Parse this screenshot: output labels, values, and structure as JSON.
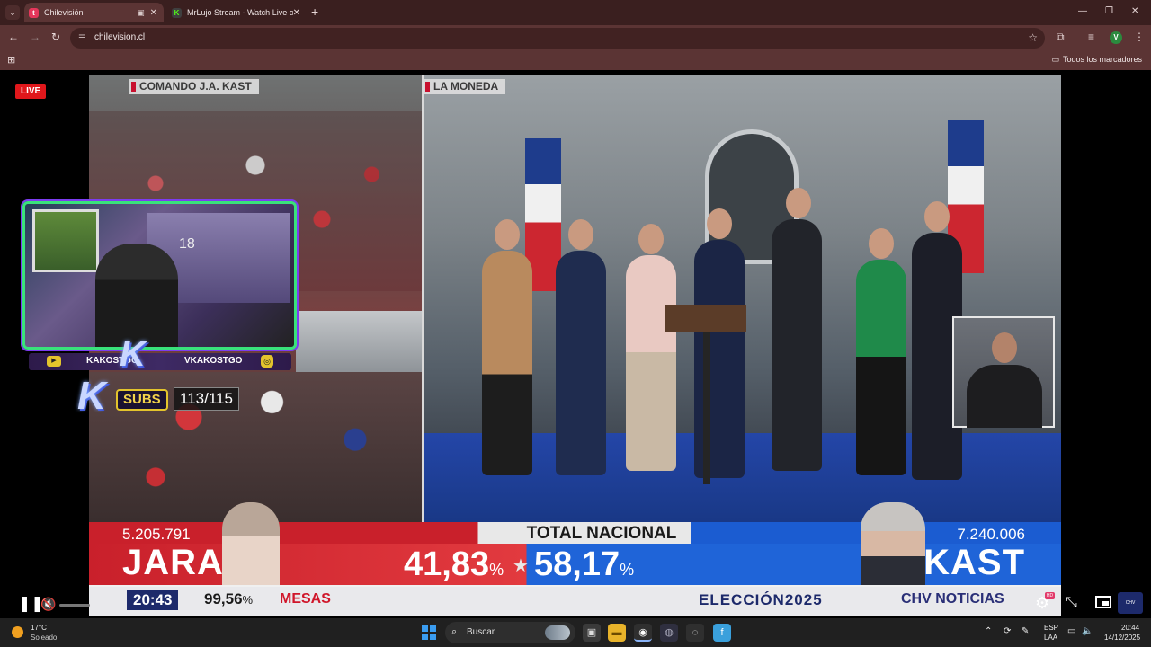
{
  "browser": {
    "tabs": [
      {
        "title": "Chilevisión",
        "favicon": "chilevision-favicon",
        "active": true
      },
      {
        "title": "MrLujo Stream - Watch Live on",
        "favicon": "kick-favicon",
        "active": false
      }
    ],
    "url": "chilevision.cl",
    "bookmarks_folder": "Todos los marcadores"
  },
  "player": {
    "live_label": "LIVE",
    "feed_left_label": "COMANDO J.A. KAST",
    "feed_right_label": "LA MONEDA"
  },
  "results": {
    "title": "TOTAL NACIONAL",
    "left": {
      "votes": "5.205.791",
      "name": "JARA",
      "percent": "41,83",
      "color": "#c9202b"
    },
    "right": {
      "votes": "7.240.006",
      "name": "KAST",
      "percent": "58,17",
      "color": "#1f64d8"
    },
    "percent_sign": "%",
    "time": "20:43",
    "mesas_percent": "99,56",
    "mesas_label": "MESAS",
    "election_label": "ELECCIÓN2025",
    "channel_label": "CHV NOTICIAS"
  },
  "overlay": {
    "room_number": "18",
    "user_left": "KAKOSTGO",
    "user_right": "VKAKOSTGO",
    "subs_label": "SUBS",
    "subs_count": "113/115",
    "k_logo": "K"
  },
  "taskbar": {
    "weather_temp": "17°C",
    "weather_desc": "Soleado",
    "search_label": "Buscar",
    "lang1": "ESP",
    "lang2": "LAA",
    "time": "20:44",
    "date": "14/12/2025"
  }
}
